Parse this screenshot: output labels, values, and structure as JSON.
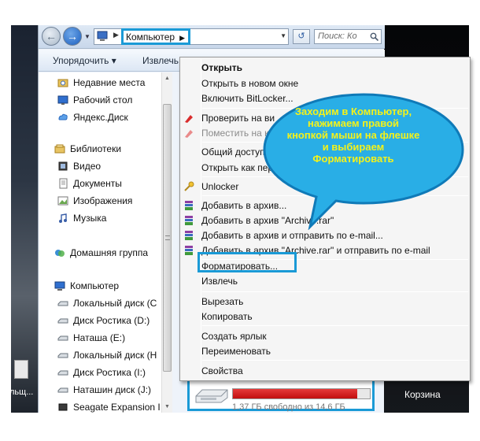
{
  "explorer": {
    "address": {
      "crumb": "Компьютер"
    },
    "search": {
      "placeholder": "Поиск: Ко"
    },
    "toolbar": {
      "organize": "Упорядочить ▾",
      "eject": "Извлечь"
    }
  },
  "navpane": {
    "favorites": [
      {
        "label": "Недавние места",
        "icon": "recent-places-icon"
      },
      {
        "label": "Рабочий стол",
        "icon": "desktop-icon"
      },
      {
        "label": "Яндекс.Диск",
        "icon": "yandex-disk-icon"
      }
    ],
    "libraries_label": "Библиотеки",
    "libraries": [
      {
        "label": "Видео",
        "icon": "video-icon"
      },
      {
        "label": "Документы",
        "icon": "documents-icon"
      },
      {
        "label": "Изображения",
        "icon": "pictures-icon"
      },
      {
        "label": "Музыка",
        "icon": "music-icon"
      }
    ],
    "homegroup_label": "Домашняя группа",
    "computer_label": "Компьютер",
    "drives": [
      {
        "label": "Локальный диск (С",
        "icon": "hard-drive-icon"
      },
      {
        "label": "Диск Ростика (D:)",
        "icon": "hard-drive-icon"
      },
      {
        "label": "Наташа (E:)",
        "icon": "hard-drive-icon"
      },
      {
        "label": "Локальный диск (H",
        "icon": "hard-drive-icon"
      },
      {
        "label": "Диск Ростика (I:)",
        "icon": "hard-drive-icon"
      },
      {
        "label": "Наташин диск (J:)",
        "icon": "hard-drive-icon"
      },
      {
        "label": "Seagate Expansion I",
        "icon": "external-drive-icon"
      }
    ]
  },
  "context_menu": {
    "items": [
      {
        "label": "Открыть",
        "bold": true
      },
      {
        "label": "Открыть в новом окне"
      },
      {
        "label": "Включить BitLocker..."
      },
      {
        "label": "Проверить на ви",
        "icon": "antivirus-icon"
      },
      {
        "label": "Поместить на ка",
        "icon": "quarantine-icon",
        "disabled": true
      },
      {
        "label": "Общий доступ",
        "submenu": true
      },
      {
        "label": "Открыть как пер"
      },
      {
        "label": "Unlocker",
        "icon": "unlocker-icon"
      },
      {
        "label": "Добавить в архив...",
        "icon": "winrar-icon"
      },
      {
        "label": "Добавить в архив \"Archive.rar\"",
        "icon": "winrar-icon"
      },
      {
        "label": "Добавить в архив и отправить по e-mail...",
        "icon": "winrar-icon"
      },
      {
        "label": "Добавить в архив \"Archive.rar\" и отправить по e-mail",
        "icon": "winrar-icon"
      },
      {
        "label": "Форматировать..."
      },
      {
        "label": "Извлечь"
      },
      {
        "label": "Вырезать"
      },
      {
        "label": "Копировать"
      },
      {
        "label": "Создать ярлык"
      },
      {
        "label": "Переименовать"
      },
      {
        "label": "Свойства"
      }
    ]
  },
  "callout": {
    "text": "Заходим в Компьютер, нажимаем правой кнопкой мыши на флешке и выбираем Форматировать",
    "fill": "#29aee6",
    "border": "#0f7ab8",
    "text_color": "#f4f21a"
  },
  "drive_tile": {
    "free_text": "1,37 ГБ свободно из 14,6 ГБ",
    "used_fraction": 0.906,
    "bar_color": "#d01616"
  },
  "desktop": {
    "recycle_bin_label": "Корзина",
    "left_label": "льщ..."
  },
  "accent": "#1a9ad6"
}
